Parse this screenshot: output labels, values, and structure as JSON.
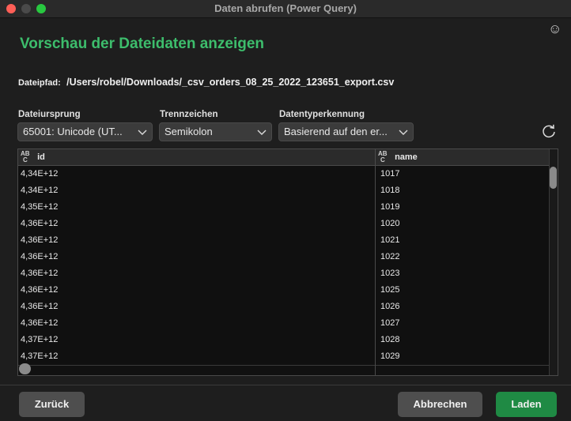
{
  "window": {
    "title": "Daten abrufen (Power Query)"
  },
  "page": {
    "title": "Vorschau der Dateidaten anzeigen"
  },
  "file": {
    "path_label": "Dateipfad:",
    "path_value": "/Users/robel/Downloads/_csv_orders_08_25_2022_123651_export.csv"
  },
  "options": {
    "origin": {
      "label": "Dateiursprung",
      "value": "65001: Unicode (UT..."
    },
    "delimiter": {
      "label": "Trennzeichen",
      "value": "Semikolon"
    },
    "datatype": {
      "label": "Datentyperkennung",
      "value": "Basierend auf den er..."
    }
  },
  "table": {
    "type_icon_text": "ABC",
    "columns": [
      "id",
      "name"
    ],
    "rows": [
      [
        "4,34E+12",
        "1017"
      ],
      [
        "4,34E+12",
        "1018"
      ],
      [
        "4,35E+12",
        "1019"
      ],
      [
        "4,36E+12",
        "1020"
      ],
      [
        "4,36E+12",
        "1021"
      ],
      [
        "4,36E+12",
        "1022"
      ],
      [
        "4,36E+12",
        "1023"
      ],
      [
        "4,36E+12",
        "1025"
      ],
      [
        "4,36E+12",
        "1026"
      ],
      [
        "4,36E+12",
        "1027"
      ],
      [
        "4,37E+12",
        "1028"
      ],
      [
        "4,37E+12",
        "1029"
      ]
    ]
  },
  "buttons": {
    "back": "Zurück",
    "cancel": "Abbrechen",
    "load": "Laden"
  },
  "colors": {
    "accent": "#3dbd6c",
    "primary_button": "#1f8a44"
  },
  "icons": [
    "smiley-icon",
    "chevron-down-icon",
    "refresh-icon",
    "abc-type-icon"
  ]
}
